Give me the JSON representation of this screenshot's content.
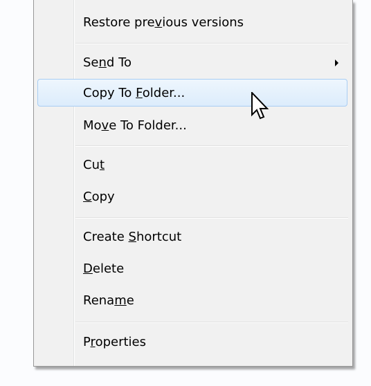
{
  "menu": {
    "items": [
      {
        "label": "Restore previous versions",
        "accel": "v"
      },
      {
        "label": "Send To",
        "accel": "n",
        "has_submenu": true
      },
      {
        "label": "Copy To Folder...",
        "accel": "F",
        "highlighted": true
      },
      {
        "label": "Move To Folder...",
        "accel": "v"
      },
      {
        "label": "Cut",
        "accel": "t"
      },
      {
        "label": "Copy",
        "accel": "C"
      },
      {
        "label": "Create Shortcut",
        "accel": "S"
      },
      {
        "label": "Delete",
        "accel": "D"
      },
      {
        "label": "Rename",
        "accel": "m"
      },
      {
        "label": "Properties",
        "accel": "r"
      }
    ]
  },
  "cursor": {
    "icon": "arrow-cursor-icon"
  },
  "colors": {
    "menu_bg": "#f1f1f1",
    "highlight_border": "#a8cdf3",
    "highlight_bg": "#dcecfc"
  }
}
